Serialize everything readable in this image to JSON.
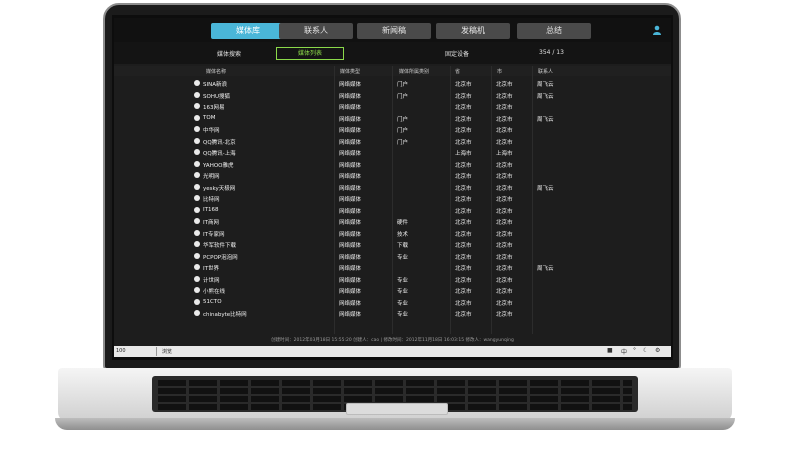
{
  "tabs": [
    {
      "label": "媒体库",
      "active": true
    },
    {
      "label": "联系人",
      "active": false
    },
    {
      "label": "新闻稿",
      "active": false
    },
    {
      "label": "发稿机",
      "active": false
    },
    {
      "label": "总结",
      "active": false
    }
  ],
  "subbar": {
    "left": "媒体搜索",
    "active": "媒体列表",
    "right": "固定设备",
    "page": "354 / 13"
  },
  "columns": [
    "媒体名称",
    "媒体类型",
    "媒体所属类别",
    "省",
    "市",
    "联系人"
  ],
  "rows": [
    {
      "name": "SINA新浪",
      "type": "网络媒体",
      "cat": "门户",
      "prov": "北京市",
      "city": "北京市",
      "contact": "周飞云"
    },
    {
      "name": "SOHU搜狐",
      "type": "网络媒体",
      "cat": "门户",
      "prov": "北京市",
      "city": "北京市",
      "contact": "周飞云"
    },
    {
      "name": "163网易",
      "type": "网络媒体",
      "cat": "",
      "prov": "北京市",
      "city": "北京市",
      "contact": ""
    },
    {
      "name": "TOM",
      "type": "网络媒体",
      "cat": "门户",
      "prov": "北京市",
      "city": "北京市",
      "contact": "周飞云"
    },
    {
      "name": "中华网",
      "type": "网络媒体",
      "cat": "门户",
      "prov": "北京市",
      "city": "北京市",
      "contact": ""
    },
    {
      "name": "QQ腾讯-北京",
      "type": "网络媒体",
      "cat": "门户",
      "prov": "北京市",
      "city": "北京市",
      "contact": ""
    },
    {
      "name": "QQ腾讯-上海",
      "type": "网络媒体",
      "cat": "",
      "prov": "上海市",
      "city": "上海市",
      "contact": ""
    },
    {
      "name": "YAHOO雅虎",
      "type": "网络媒体",
      "cat": "",
      "prov": "北京市",
      "city": "北京市",
      "contact": ""
    },
    {
      "name": "光明网",
      "type": "网络媒体",
      "cat": "",
      "prov": "北京市",
      "city": "北京市",
      "contact": ""
    },
    {
      "name": "yesky天极网",
      "type": "网络媒体",
      "cat": "",
      "prov": "北京市",
      "city": "北京市",
      "contact": "周飞云"
    },
    {
      "name": "比特网",
      "type": "网络媒体",
      "cat": "",
      "prov": "北京市",
      "city": "北京市",
      "contact": ""
    },
    {
      "name": "IT168",
      "type": "网络媒体",
      "cat": "",
      "prov": "北京市",
      "city": "北京市",
      "contact": ""
    },
    {
      "name": "IT商网",
      "type": "网络媒体",
      "cat": "硬件",
      "prov": "北京市",
      "city": "北京市",
      "contact": ""
    },
    {
      "name": "IT专家网",
      "type": "网络媒体",
      "cat": "技术",
      "prov": "北京市",
      "city": "北京市",
      "contact": ""
    },
    {
      "name": "华军软件下载",
      "type": "网络媒体",
      "cat": "下载",
      "prov": "北京市",
      "city": "北京市",
      "contact": ""
    },
    {
      "name": "PCPOP泡泡网",
      "type": "网络媒体",
      "cat": "专业",
      "prov": "北京市",
      "city": "北京市",
      "contact": ""
    },
    {
      "name": "IT世界",
      "type": "网络媒体",
      "cat": "",
      "prov": "北京市",
      "city": "北京市",
      "contact": "周飞云"
    },
    {
      "name": "计世网",
      "type": "网络媒体",
      "cat": "专业",
      "prov": "北京市",
      "city": "北京市",
      "contact": ""
    },
    {
      "name": "小熊在线",
      "type": "网络媒体",
      "cat": "专业",
      "prov": "北京市",
      "city": "北京市",
      "contact": ""
    },
    {
      "name": "51CTO",
      "type": "网络媒体",
      "cat": "专业",
      "prov": "北京市",
      "city": "北京市",
      "contact": ""
    },
    {
      "name": "chinabyte比特网",
      "type": "网络媒体",
      "cat": "专业",
      "prov": "北京市",
      "city": "北京市",
      "contact": ""
    }
  ],
  "footer_info": "创建时间：2012年03月18日 15:55:20 创建人：cao | 修改时间：2012年11月18日 16:03:15 修改人：wangyunqing",
  "statusbar": {
    "zoom": "100",
    "mode": "浏览"
  },
  "colors": {
    "accent": "#4ab6d8",
    "active_sub": "#8bd94a"
  }
}
